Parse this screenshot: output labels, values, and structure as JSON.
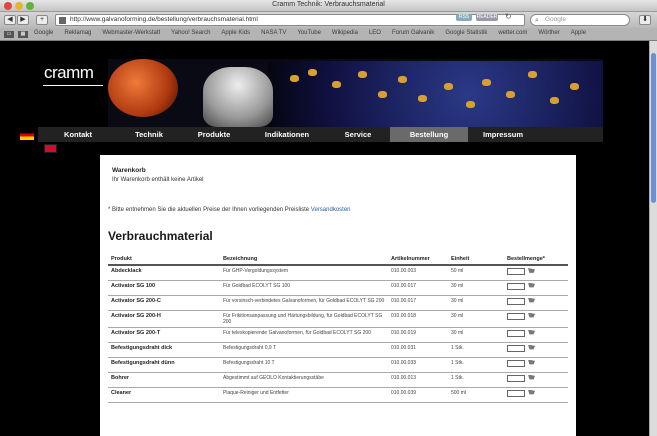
{
  "window": {
    "title": "Cramm Technik: Verbrauchsmaterial"
  },
  "toolbar": {
    "back": "◀",
    "forward": "▶",
    "add": "+",
    "url": "http://www.galvanoforming.de/bestellung/verbrauchsmaterial.html",
    "rss": "RSS",
    "reader": "READER",
    "reload": "↻",
    "search_placeholder": "Google",
    "download": "⬇"
  },
  "bookmarks": [
    "Google",
    "Reklamag",
    "Webmaster-Werkstatt",
    "Yahoo! Search",
    "Apple Kids",
    "NASA TV",
    "YouTube",
    "Wikipedia",
    "LEO",
    "Forum Galvanik",
    "Google Statistik",
    "wetter.com",
    "Wörther",
    "Apple"
  ],
  "nav": {
    "items": [
      "Kontakt",
      "Technik",
      "Produkte",
      "Indikationen",
      "Service",
      "Bestellung",
      "Impressum"
    ],
    "active": "Bestellung"
  },
  "logo": "cramm",
  "cart": {
    "title": "Warenkorb",
    "empty": "Ihr Warenkorb enthält keine Artikel"
  },
  "note": {
    "text": "* Bitte entnehmen Sie die aktuellen Preise der Ihnen vorliegenden Preisliste ",
    "link": "Versandkosten"
  },
  "heading": "Verbrauchmaterial",
  "table": {
    "headers": [
      "Produkt",
      "Bezeichnung",
      "Artikelnummer",
      "Einheit",
      "Bestellmenge*"
    ],
    "rows": [
      {
        "product": "Abdecklack",
        "desc": "Für GHP-Vergoldungssystem",
        "art": "010.00.003",
        "unit": "50 ml"
      },
      {
        "product": "Activator SG 100",
        "desc": "Für Goldbad ECOLYT SG 100",
        "art": "010.00.017",
        "unit": "30 ml"
      },
      {
        "product": "Activator SG 200-C",
        "desc": "Für vorsinsch-verbindetes Galvanoformen, für Goldbad ECOLYT SG 200",
        "art": "010.00.017",
        "unit": "30 ml"
      },
      {
        "product": "Activator SG 200-H",
        "desc": "Für Frikitionsanpassung und Härtungsbildung, für Goldbad ECOLYT SG 200",
        "art": "010.00.018",
        "unit": "30 ml"
      },
      {
        "product": "Activator SG 200-T",
        "desc": "Für teleskopierende Galvanoformen, für Goldbad ECOLYT SG 200",
        "art": "010.00.019",
        "unit": "30 ml"
      },
      {
        "product": "Befestigungsdraht dick",
        "desc": "Befestigungsdraht 0,9 T",
        "art": "010.00.031",
        "unit": "1 Stk."
      },
      {
        "product": "Befestigungsdraht dünn",
        "desc": "Befestigungsdraht 10 T",
        "art": "010.00.033",
        "unit": "1 Stk."
      },
      {
        "product": "Bohrer",
        "desc": "Abgestimmt auf GEOLO Kontaktierungsstäbe",
        "art": "010.00.013",
        "unit": "1 Stk."
      },
      {
        "product": "Cleaner",
        "desc": "Plaque-Reiniger und Entfetter",
        "art": "010.00.039",
        "unit": "500 ml"
      }
    ]
  }
}
